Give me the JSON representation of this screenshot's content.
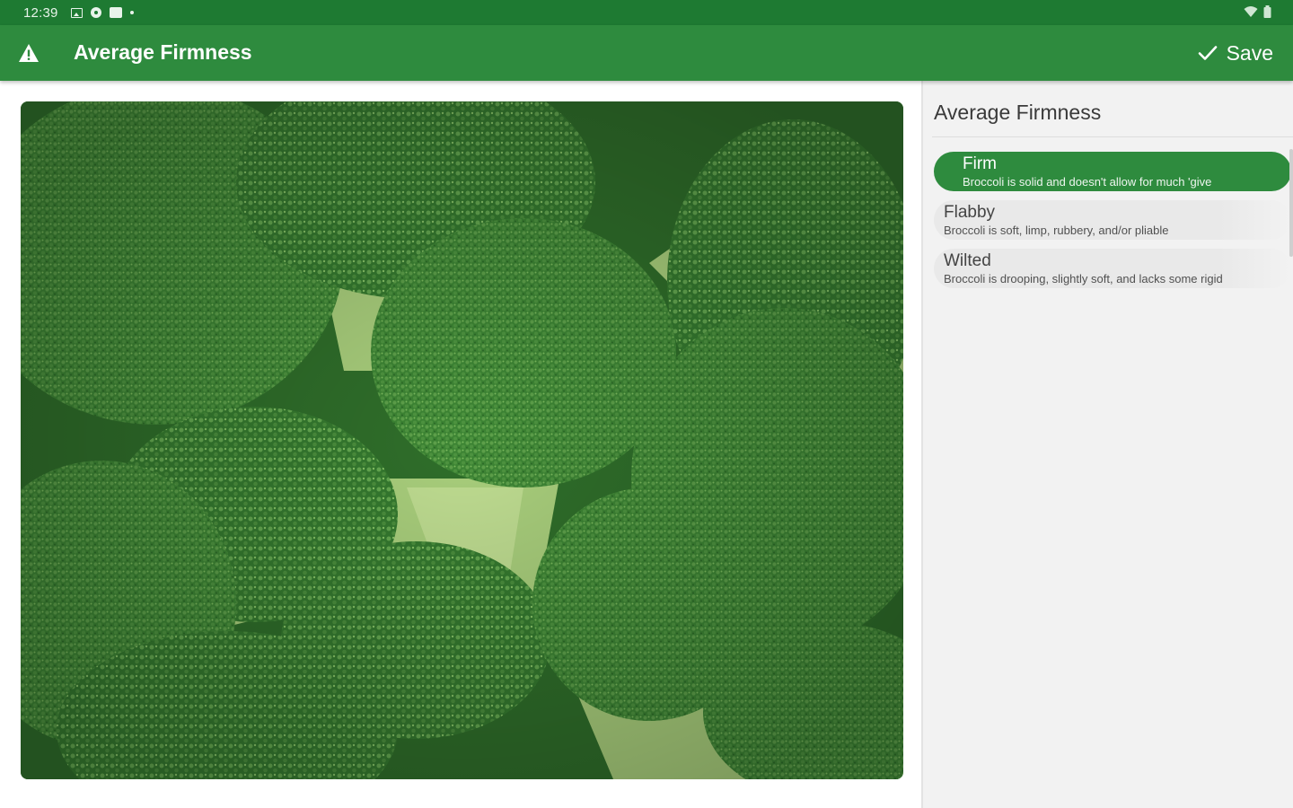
{
  "status_bar": {
    "time": "12:39"
  },
  "app_bar": {
    "title": "Average Firmness",
    "save_label": "Save",
    "colors": {
      "app_bar": "#2e8b3e",
      "status_bar": "#1e7a32"
    }
  },
  "panel": {
    "title": "Average Firmness",
    "options": [
      {
        "label": "Firm",
        "description": "Broccoli is solid and doesn't allow for much 'give",
        "selected": true
      },
      {
        "label": "Flabby",
        "description": "Broccoli is soft, limp, rubbery, and/or pliable",
        "selected": false
      },
      {
        "label": "Wilted",
        "description": "Broccoli is drooping, slightly soft, and lacks some rigid",
        "selected": false
      }
    ]
  },
  "icons": {
    "left": "warning-icon",
    "save": "check-icon"
  }
}
